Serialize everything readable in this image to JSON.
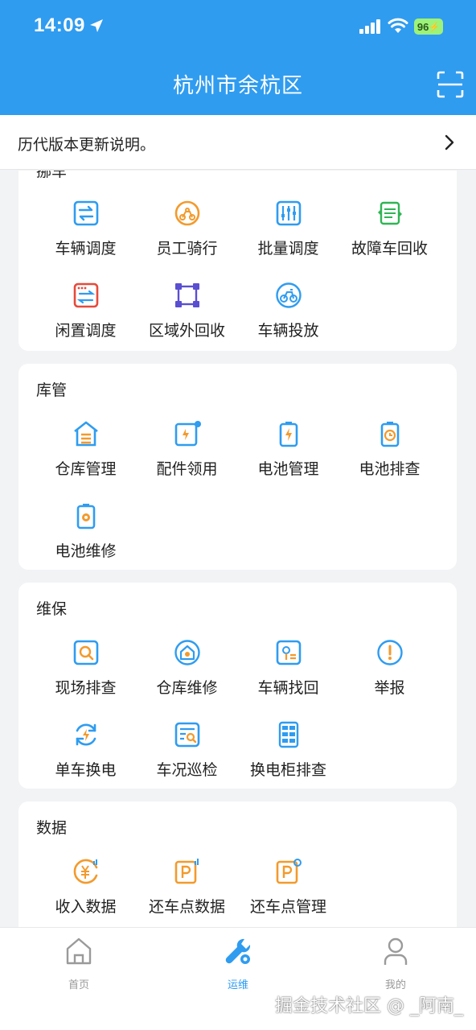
{
  "status_bar": {
    "time": "14:09",
    "battery": "96"
  },
  "header": {
    "title": "杭州市余杭区"
  },
  "notice": {
    "text": "历代版本更新说明。"
  },
  "sections": {
    "move": {
      "title": "挪车",
      "items": [
        {
          "label": "车辆调度",
          "icon": "vehicle-dispatch-icon"
        },
        {
          "label": "员工骑行",
          "icon": "staff-riding-icon"
        },
        {
          "label": "批量调度",
          "icon": "batch-dispatch-icon"
        },
        {
          "label": "故障车回收",
          "icon": "faulty-recycle-icon"
        },
        {
          "label": "闲置调度",
          "icon": "idle-dispatch-icon"
        },
        {
          "label": "区域外回收",
          "icon": "out-of-area-icon"
        },
        {
          "label": "车辆投放",
          "icon": "vehicle-deploy-icon"
        }
      ]
    },
    "warehouse": {
      "title": "库管",
      "items": [
        {
          "label": "仓库管理",
          "icon": "warehouse-icon"
        },
        {
          "label": "配件领用",
          "icon": "parts-collect-icon"
        },
        {
          "label": "电池管理",
          "icon": "battery-manage-icon"
        },
        {
          "label": "电池排查",
          "icon": "battery-check-icon"
        },
        {
          "label": "电池维修",
          "icon": "battery-repair-icon"
        }
      ]
    },
    "maintenance": {
      "title": "维保",
      "items": [
        {
          "label": "现场排查",
          "icon": "site-check-icon"
        },
        {
          "label": "仓库维修",
          "icon": "warehouse-repair-icon"
        },
        {
          "label": "车辆找回",
          "icon": "vehicle-retrieve-icon"
        },
        {
          "label": "举报",
          "icon": "report-icon"
        },
        {
          "label": "单车换电",
          "icon": "battery-swap-icon"
        },
        {
          "label": "车况巡检",
          "icon": "condition-inspect-icon"
        },
        {
          "label": "换电柜排查",
          "icon": "swap-cabinet-icon"
        }
      ]
    },
    "data": {
      "title": "数据",
      "items": [
        {
          "label": "收入数据",
          "icon": "income-data-icon"
        },
        {
          "label": "还车点数据",
          "icon": "return-point-data-icon"
        },
        {
          "label": "还车点管理",
          "icon": "return-point-manage-icon"
        }
      ]
    }
  },
  "tabbar": {
    "tabs": [
      {
        "label": "首页",
        "icon": "home-icon"
      },
      {
        "label": "运维",
        "icon": "ops-icon"
      },
      {
        "label": "我的",
        "icon": "profile-icon"
      }
    ],
    "active": "运维"
  },
  "colors": {
    "primary": "#2f9cf0",
    "orange": "#f39a2c",
    "green": "#2fb554",
    "red": "#e64a3b",
    "purple": "#5a4fd0"
  },
  "watermark": "掘金技术社区 @ _阿南_"
}
